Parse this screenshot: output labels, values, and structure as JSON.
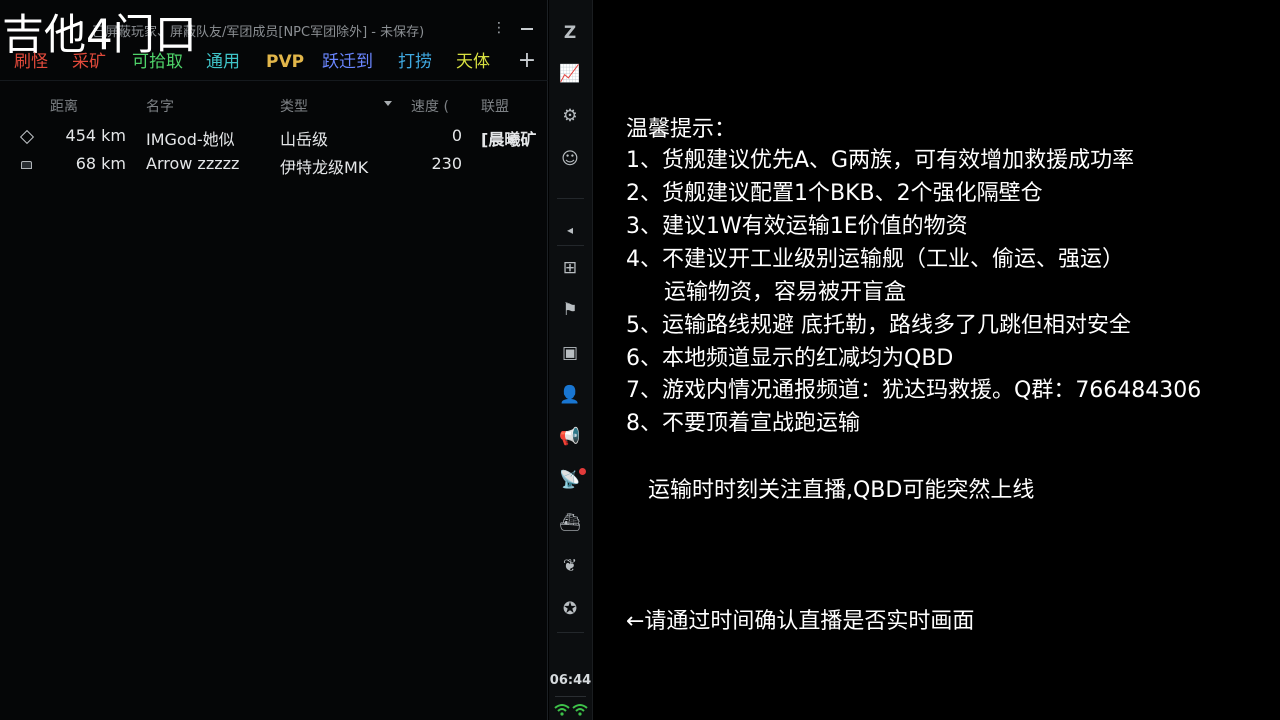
{
  "streamer": {
    "name": "吉他4门口"
  },
  "window": {
    "title": "已屏蔽玩家、屏蔽队友/军团成员[NPC军团除外] - 未保存)",
    "more_glyph": "⋮"
  },
  "tabs": [
    {
      "label": "刷怪",
      "color": "#e24a3b"
    },
    {
      "label": "采矿",
      "color": "#e24a3b"
    },
    {
      "label": "可拾取",
      "color": "#4fd46a"
    },
    {
      "label": "通用",
      "color": "#3fc4c8"
    },
    {
      "label": "PVP",
      "color": "#e2b64a"
    },
    {
      "label": "跃迁到",
      "color": "#6a86ff"
    },
    {
      "label": "打捞",
      "color": "#3fa8e0"
    },
    {
      "label": "天体",
      "color": "#d8e040"
    }
  ],
  "tab_add_label": "+",
  "table": {
    "headers": [
      "距离",
      "名字",
      "类型",
      "速度 (",
      "联盟"
    ],
    "rows": [
      {
        "icon": "diamond-icon",
        "distance": "454 km",
        "name": "IMGod-她似",
        "type": "山岳级",
        "speed": "0",
        "alliance": "[晨曦矿"
      },
      {
        "icon": "hauler-icon",
        "distance": "68 km",
        "name": "Arrow zzzzz",
        "type": "伊特龙级MK",
        "speed": "230",
        "alliance": ""
      }
    ]
  },
  "neocom": {
    "buttons": [
      {
        "name": "eve-menu-icon",
        "glyph": "Z"
      },
      {
        "name": "market-chart-icon",
        "glyph": "📈"
      },
      {
        "name": "skills-gear-icon",
        "glyph": "⚙"
      },
      {
        "name": "character-icon",
        "glyph": "☺"
      },
      {
        "name": "collapse-arrow-icon",
        "glyph": "◂"
      },
      {
        "name": "fitting-icon",
        "glyph": "⊞"
      },
      {
        "name": "map-icon",
        "glyph": "⚑"
      },
      {
        "name": "inventory-icon",
        "glyph": "▣"
      },
      {
        "name": "people-icon",
        "glyph": "👤"
      },
      {
        "name": "megaphone-icon",
        "glyph": "📢"
      },
      {
        "name": "satellite-icon",
        "glyph": "📡"
      },
      {
        "name": "ship-hangar-icon",
        "glyph": "⛴"
      },
      {
        "name": "wings-icon",
        "glyph": "❦"
      },
      {
        "name": "corporation-icon",
        "glyph": "✪"
      }
    ],
    "clock": "06:44"
  },
  "tips": {
    "lines": [
      "温馨提示：",
      "1、货舰建议优先A、G两族，可有效增加救援成功率",
      "2、货舰建议配置1个BKB、2个强化隔壁仓",
      "3、建议1W有效运输1E价值的物资",
      "4、不建议开工业级别运输舰（工业、偷运、强运）",
      "运输物资，容易被开盲盒",
      "5、运输路线规避 底托勒，路线多了几跳但相对安全",
      "6、本地频道显示的红减均为QBD",
      "7、游戏内情况通报频道：犹达玛救援。Q群：766484306",
      "8、不要顶着宣战跑运输"
    ],
    "notice": "运输时时刻关注直播,QBD可能突然上线",
    "time_check": "←请通过时间确认直播是否实时画面"
  }
}
